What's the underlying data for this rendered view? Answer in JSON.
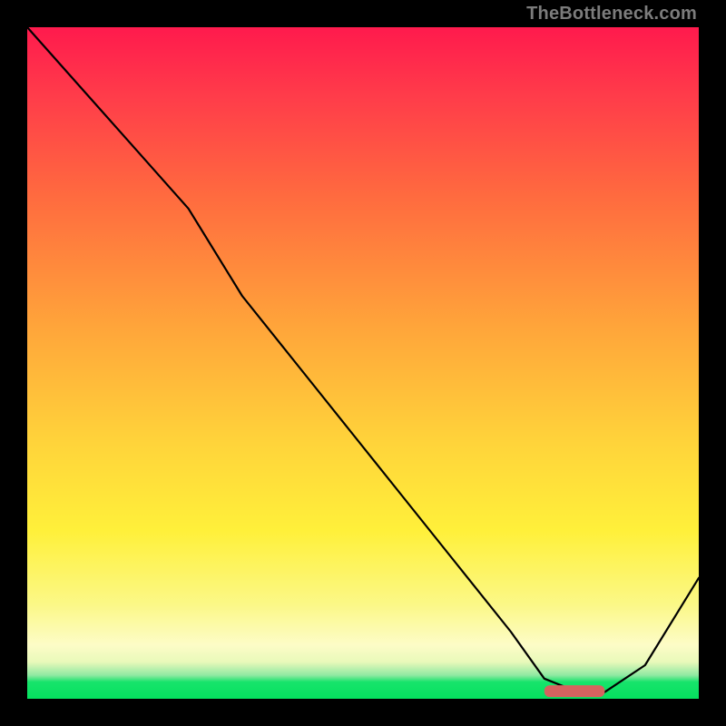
{
  "watermark": "TheBottleneck.com",
  "colors": {
    "gradient_top": "#ff1a4d",
    "gradient_mid": "#ffd43a",
    "gradient_bottom": "#05e25f",
    "curve": "#000000",
    "marker": "#d6625f",
    "frame": "#000000"
  },
  "chart_data": {
    "type": "line",
    "title": "",
    "xlabel": "",
    "ylabel": "",
    "xlim": [
      0,
      100
    ],
    "ylim": [
      0,
      100
    ],
    "grid": false,
    "legend": false,
    "series": [
      {
        "name": "bottleneck-curve",
        "x": [
          0,
          8,
          16,
          24,
          32,
          40,
          48,
          56,
          64,
          72,
          77,
          82,
          86,
          92,
          100
        ],
        "y": [
          100,
          91,
          82,
          73,
          60,
          50,
          40,
          30,
          20,
          10,
          3,
          1,
          1,
          5,
          18
        ]
      }
    ],
    "annotations": [
      {
        "name": "optimal-range-marker",
        "shape": "rounded-bar",
        "x_start": 77,
        "x_end": 86,
        "y": 1.2,
        "color": "#d6625f"
      }
    ]
  }
}
